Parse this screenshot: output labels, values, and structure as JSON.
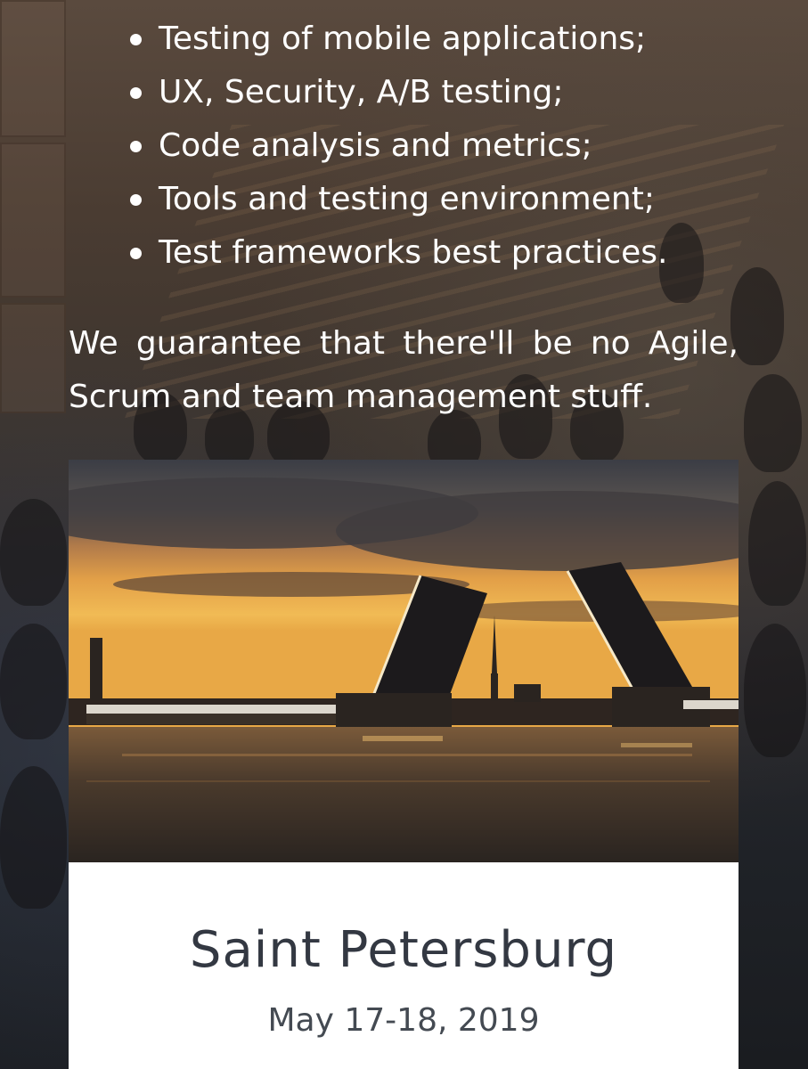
{
  "features": {
    "items": [
      "Testing of mobile applications;",
      "UX, Security, A/B testing;",
      "Code analysis and metrics;",
      "Tools and testing environment;",
      "Test frameworks best practices."
    ]
  },
  "guarantee_text": "We guarantee that there'll be no Agile, Scrum and team management stuff.",
  "event_card": {
    "image_subject": "drawbridges-at-sunset",
    "city": "Saint Petersburg",
    "date": "May 17-18, 2019"
  },
  "colors": {
    "text_light": "#ffffff",
    "card_title": "#333842",
    "card_bg": "#ffffff"
  }
}
